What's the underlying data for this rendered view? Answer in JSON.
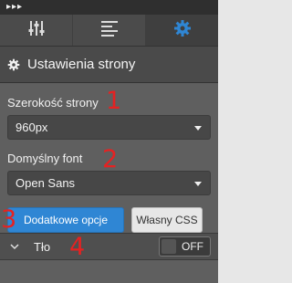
{
  "topbar": {
    "label": "▸▸▸"
  },
  "tabs": [
    {
      "icon": "sliders-icon",
      "active": false
    },
    {
      "icon": "list-icon",
      "active": false
    },
    {
      "icon": "gear-icon",
      "active": true
    }
  ],
  "section": {
    "title": "Ustawienia strony",
    "icon": "gear-icon"
  },
  "page_width": {
    "label": "Szerokość strony",
    "value": "960px",
    "annotation": "1"
  },
  "default_font": {
    "label": "Domyślny font",
    "value": "Open Sans",
    "annotation": "2"
  },
  "buttons": {
    "extra_options": "Dodatkowe opcje",
    "custom_css": "Własny CSS",
    "annotation": "3"
  },
  "background": {
    "label": "Tło",
    "annotation": "4",
    "toggle_state": "OFF"
  },
  "colors": {
    "panel": "#5f5f5f",
    "accent": "#2f86d4",
    "annotation": "#e52222"
  }
}
